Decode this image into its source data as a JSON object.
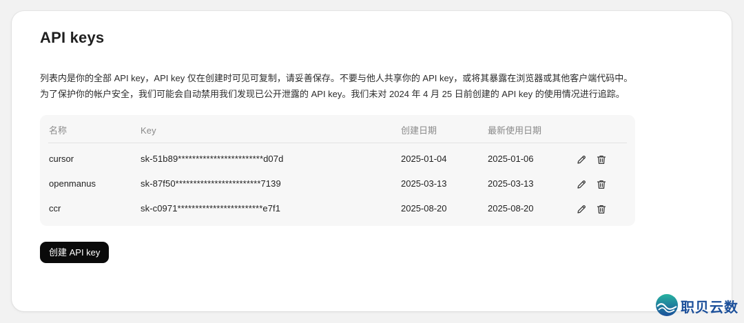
{
  "page": {
    "title": "API keys",
    "description_lines": [
      "列表内是你的全部 API key，API key 仅在创建时可见可复制，请妥善保存。不要与他人共享你的 API key，或将其暴露在浏览器或其他客户端代码中。",
      "为了保护你的帐户安全，我们可能会自动禁用我们发现已公开泄露的 API key。我们未对 2024 年 4 月 25 日前创建的 API key 的使用情况进行追踪。"
    ]
  },
  "table": {
    "headers": {
      "name": "名称",
      "key": "Key",
      "created": "创建日期",
      "last_used": "最新使用日期"
    },
    "rows": [
      {
        "name": "cursor",
        "key": "sk-51b89************************d07d",
        "created": "2025-01-04",
        "last_used": "2025-01-06"
      },
      {
        "name": "openmanus",
        "key": "sk-87f50************************7139",
        "created": "2025-03-13",
        "last_used": "2025-03-13"
      },
      {
        "name": "ccr",
        "key": "sk-c0971************************e7f1",
        "created": "2025-08-20",
        "last_used": "2025-08-20"
      }
    ],
    "row_actions": [
      "edit-icon",
      "delete-icon"
    ]
  },
  "actions": {
    "create_label": "创建 API key"
  },
  "watermark": {
    "text": "职贝云数",
    "icon": "wave-logo-icon"
  },
  "colors": {
    "button_bg": "#0a0a0a",
    "table_bg": "#f7f7f7",
    "watermark_text": "#1b4f9a"
  }
}
